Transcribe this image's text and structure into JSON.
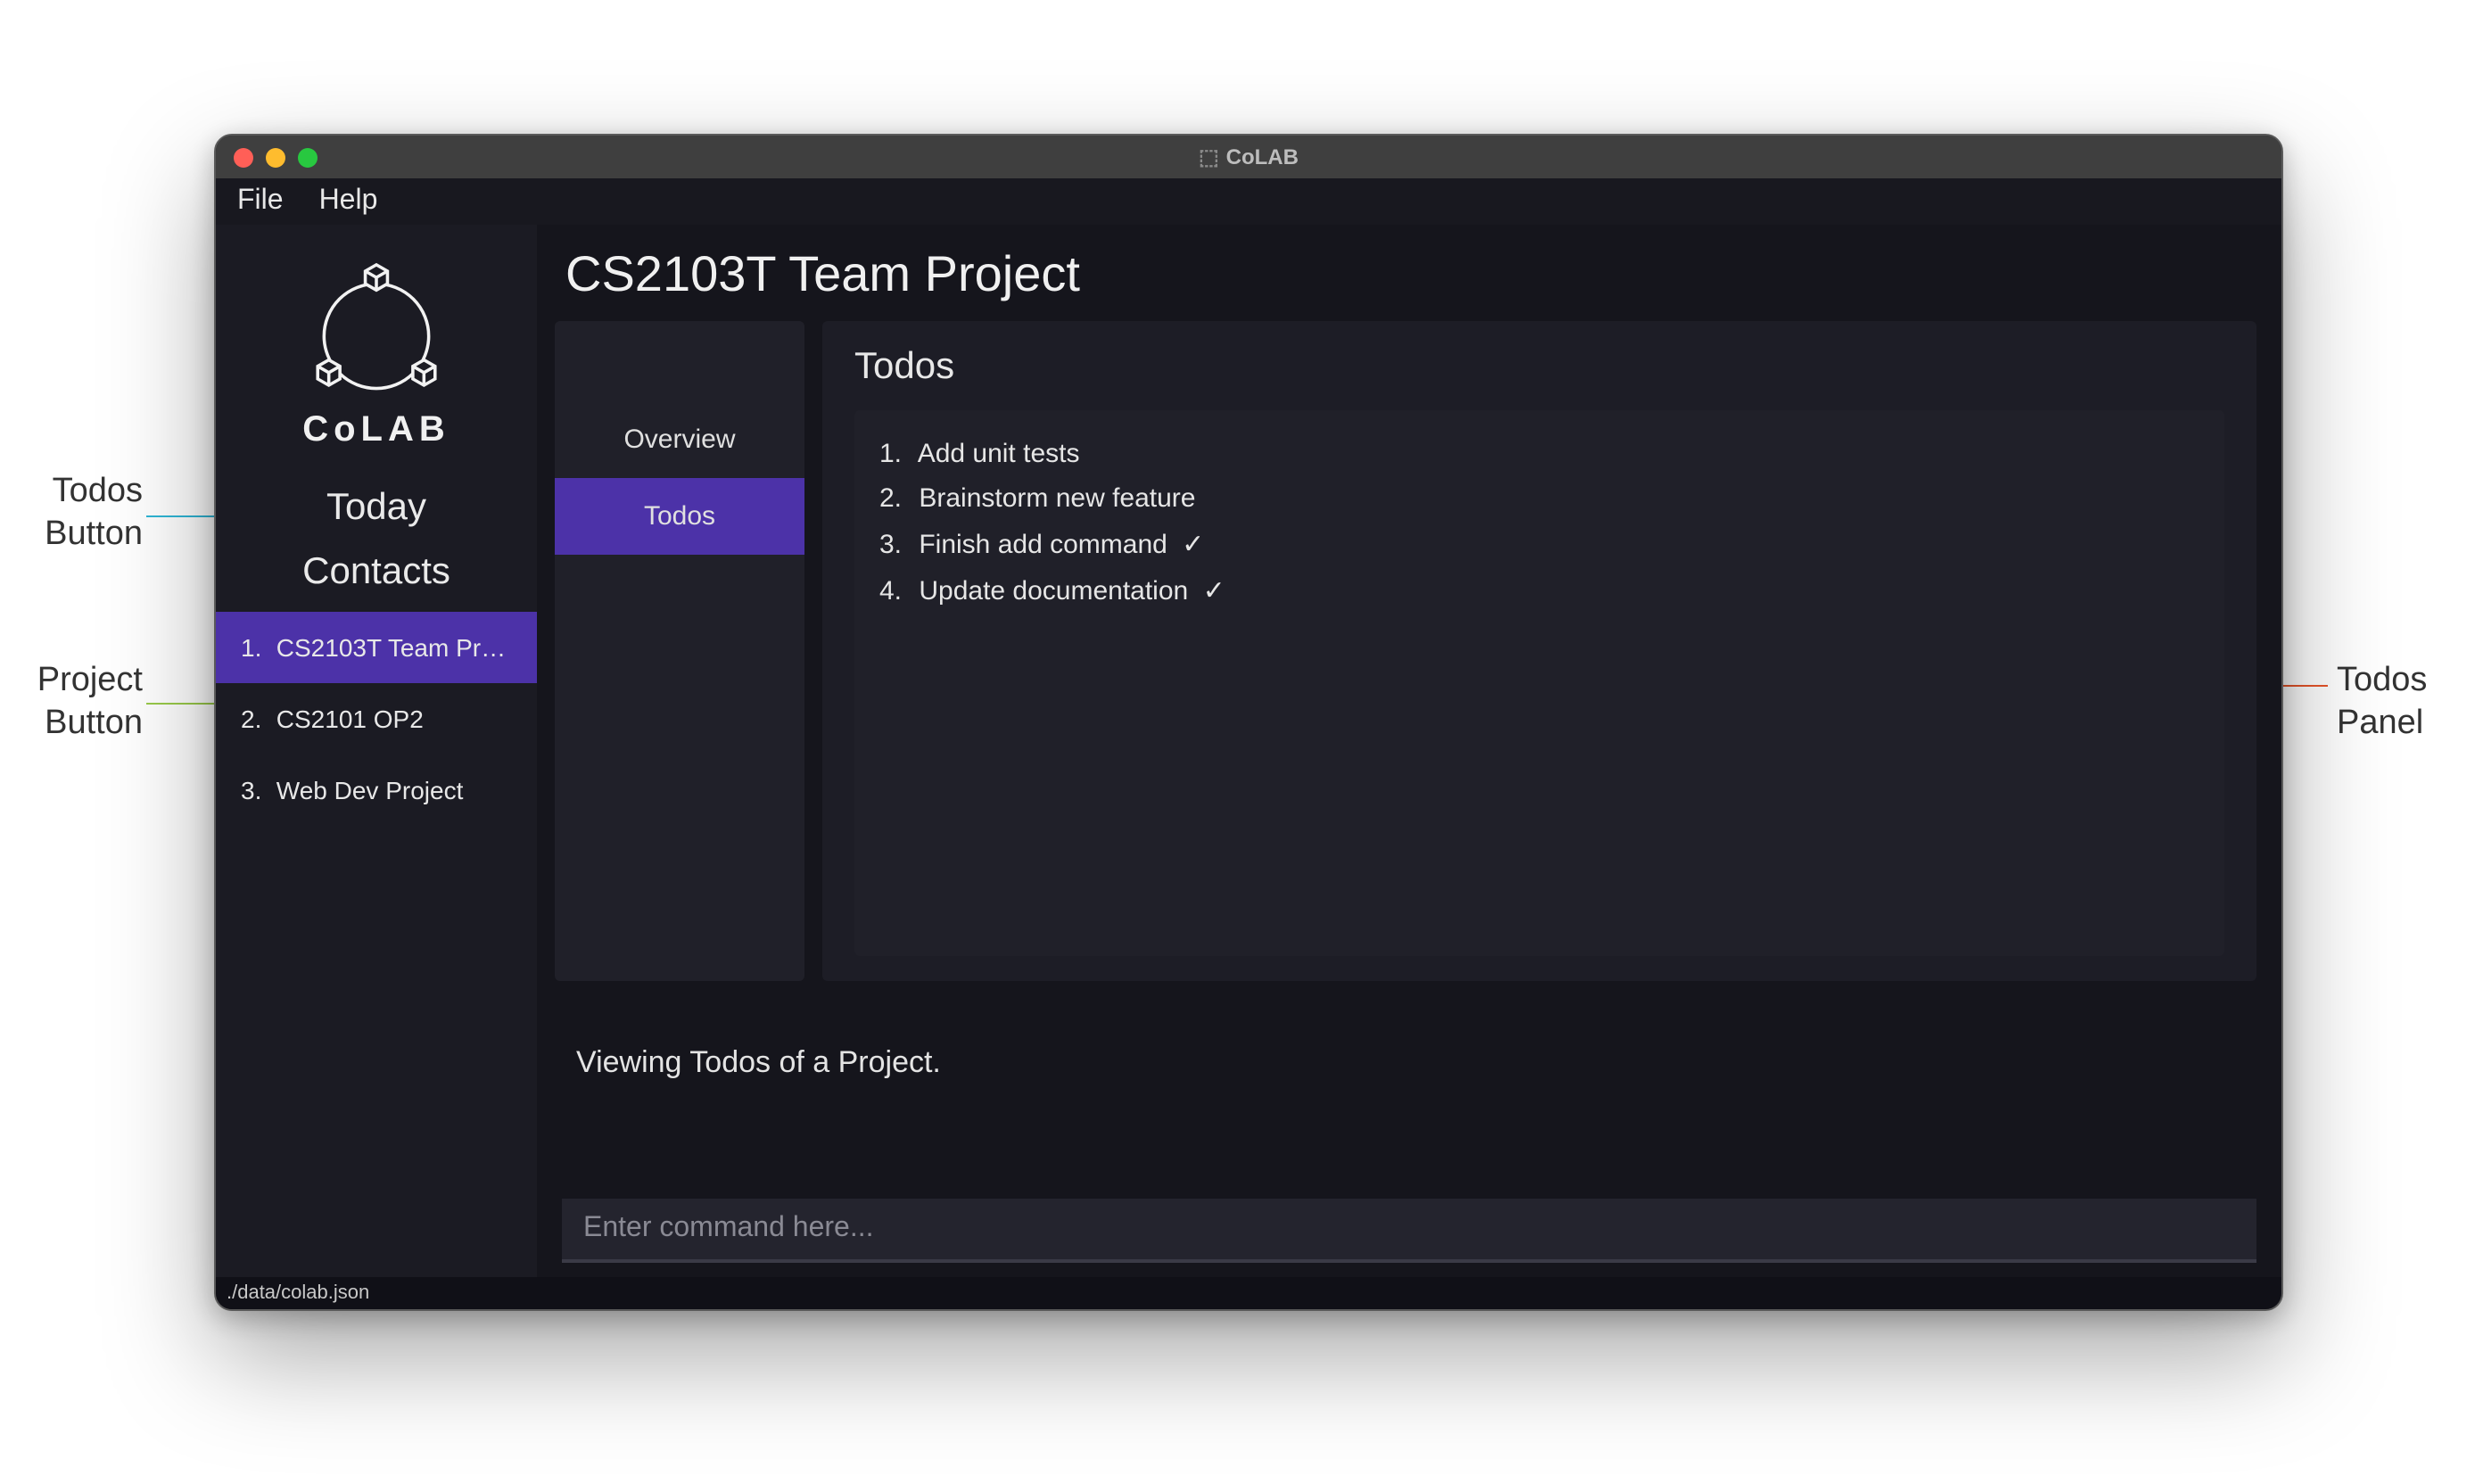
{
  "window": {
    "title": "CoLAB",
    "statusbar_path": "./data/colab.json"
  },
  "menubar": {
    "file": "File",
    "help": "Help"
  },
  "sidebar": {
    "brand": "CoLAB",
    "today": "Today",
    "contacts": "Contacts",
    "projects": [
      {
        "num": "1.",
        "label": "CS2103T Team Proj…"
      },
      {
        "num": "2.",
        "label": "CS2101 OP2"
      },
      {
        "num": "3.",
        "label": "Web Dev Project"
      }
    ]
  },
  "main": {
    "header": "CS2103T Team Project",
    "tabs": {
      "overview": "Overview",
      "todos": "Todos"
    },
    "todos_heading": "Todos",
    "todos": [
      {
        "num": "1.",
        "text": "Add unit tests",
        "done": false
      },
      {
        "num": "2.",
        "text": "Brainstorm new feature",
        "done": false
      },
      {
        "num": "3.",
        "text": "Finish add command",
        "done": true
      },
      {
        "num": "4.",
        "text": "Update documentation",
        "done": true
      }
    ],
    "status_message": "Viewing Todos of a Project.",
    "command_placeholder": "Enter command here..."
  },
  "callouts": {
    "todos_button": "Todos\nButton",
    "project_button": "Project\nButton",
    "todos_panel": "Todos\nPanel"
  },
  "colors": {
    "accent": "#4c32a8",
    "hi_orange": "#e8552a",
    "hi_cyan": "#2fb6d6",
    "hi_green": "#9acb4a"
  }
}
